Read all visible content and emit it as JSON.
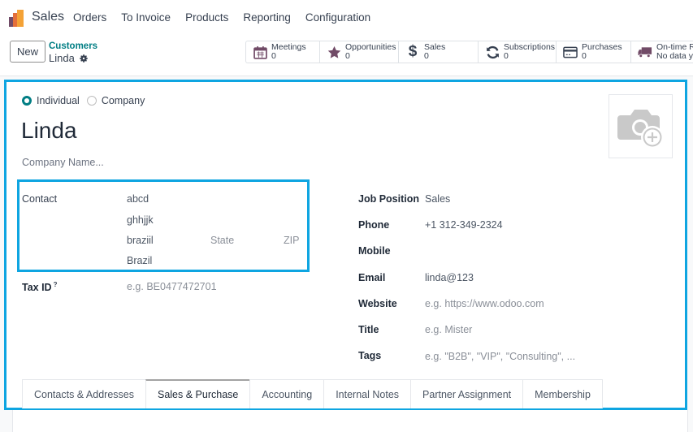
{
  "app": {
    "name": "Sales",
    "menu": [
      "Orders",
      "To Invoice",
      "Products",
      "Reporting",
      "Configuration"
    ]
  },
  "control": {
    "new_label": "New",
    "breadcrumb": "Customers",
    "record_name": "Linda"
  },
  "smart_buttons": [
    {
      "icon": "calendar-icon",
      "label": "Meetings",
      "value": "0"
    },
    {
      "icon": "star-icon",
      "label": "Opportunities",
      "value": "0"
    },
    {
      "icon": "dollar-icon",
      "label": "Sales",
      "value": "0"
    },
    {
      "icon": "refresh-icon",
      "label": "Subscriptions",
      "value": "0"
    },
    {
      "icon": "credit-card-icon",
      "label": "Purchases",
      "value": "0"
    },
    {
      "icon": "truck-icon",
      "label": "On-time R",
      "value": "No data y"
    }
  ],
  "form": {
    "type_options": [
      "Individual",
      "Company"
    ],
    "type_selected": "Individual",
    "name": "Linda",
    "company_placeholder": "Company Name...",
    "address": {
      "label": "Contact",
      "street": "abcd",
      "street2": "ghhjjk",
      "city": "braziil",
      "state_placeholder": "State",
      "zip_placeholder": "ZIP",
      "country": "Brazil"
    },
    "tax_id": {
      "label": "Tax ID",
      "help": "?",
      "placeholder": "e.g. BE0477472701"
    },
    "right_fields": [
      {
        "label": "Job Position",
        "value": "Sales",
        "placeholder": ""
      },
      {
        "label": "Phone",
        "value": "+1 312-349-2324",
        "placeholder": ""
      },
      {
        "label": "Mobile",
        "value": "",
        "placeholder": ""
      },
      {
        "label": "Email",
        "value": "linda@123",
        "placeholder": ""
      },
      {
        "label": "Website",
        "value": "",
        "placeholder": "e.g. https://www.odoo.com"
      },
      {
        "label": "Title",
        "value": "",
        "placeholder": "e.g. Mister"
      },
      {
        "label": "Tags",
        "value": "",
        "placeholder": "e.g. \"B2B\", \"VIP\", \"Consulting\", ..."
      }
    ]
  },
  "tabs": [
    {
      "label": "Contacts & Addresses",
      "active": false
    },
    {
      "label": "Sales & Purchase",
      "active": true
    },
    {
      "label": "Accounting",
      "active": false
    },
    {
      "label": "Internal Notes",
      "active": false
    },
    {
      "label": "Partner Assignment",
      "active": false
    },
    {
      "label": "Membership",
      "active": false
    }
  ],
  "colors": {
    "accent": "#017e84",
    "brand": "#714b67",
    "highlight": "#0ea5e1"
  }
}
